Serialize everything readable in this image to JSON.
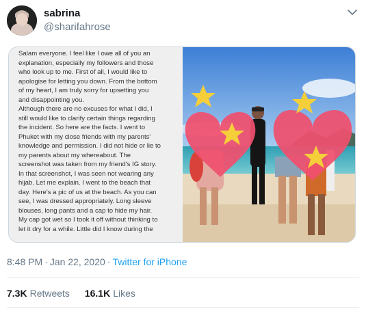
{
  "user": {
    "name": "sabrina",
    "handle": "@sharifahrose"
  },
  "media": {
    "text_lines": [
      "Salam everyone. I feel like I owe all of you an",
      "explanation, especially my followers and those",
      "who look up to me. First of all, I would like to",
      "apologise for letting you down. From the bottom",
      "of my heart, I am truly sorry for upsetting you",
      "and disappointing you.",
      "Although there are no excuses for what I did, I",
      "still would like to clarify certain things regarding",
      "the incident. So here are the facts. I went to",
      "Phuket with my close friends with my parents'",
      "knowledge and permission. I did not hide or lie to",
      "my parents about my whereabout. The",
      "screenshot was taken from my friend's IG story.",
      "In that screenshot, I was seen not wearing any",
      "hijab. Let me explain. I went to the beach that",
      "day. Here's a pic of us at the beach. As you can",
      "see, I was dressed appropriately. Long sleeve",
      "blouses, long pants and a cap to hide my hair.",
      "My cap got wet so I took it off without thinking to",
      "let it dry for a while. Little did I know during the"
    ]
  },
  "meta": {
    "time": "8:48 PM",
    "separator": "·",
    "date": "Jan 22, 2020",
    "client": "Twitter for iPhone"
  },
  "stats": {
    "retweets_count": "7.3K",
    "retweets_label": "Retweets",
    "likes_count": "16.1K",
    "likes_label": "Likes"
  },
  "icons": {
    "menu": "chevron-down-icon",
    "sticker": "heart-sticker"
  },
  "colors": {
    "link": "#1da1f2",
    "secondary": "#657786",
    "heart": "#f0506e",
    "star": "#f5cf3a"
  }
}
